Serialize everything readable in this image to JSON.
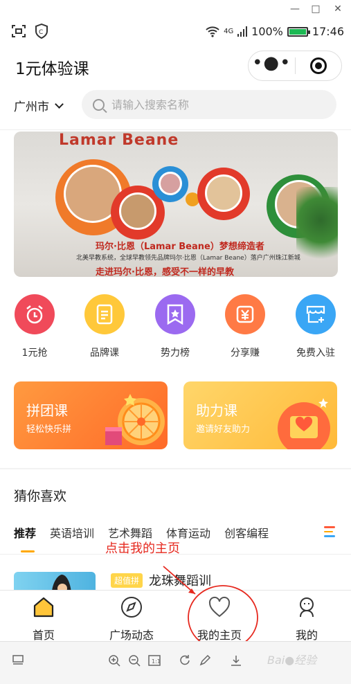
{
  "status": {
    "network": "4G",
    "battery": "100%",
    "time": "17:46"
  },
  "header": {
    "title": "1元体验课"
  },
  "location": {
    "city": "广州市"
  },
  "search": {
    "placeholder": "请输入搜索名称"
  },
  "banner": {
    "logo": "Lamar Beane",
    "slogan": "玛尔·比恩（Lamar Beane）梦想缔造者",
    "sub": "北美早教系统，全球早教领先品牌玛尔·比恩（Lamar Beane）落户广州珠江新城",
    "line3": "走进玛尔·比恩，感受不一样的早教"
  },
  "categories": [
    {
      "label": "1元抢",
      "color": "#f04a5a",
      "icon": "alarm-clock-icon"
    },
    {
      "label": "品牌课",
      "color": "#ffc83a",
      "icon": "document-icon"
    },
    {
      "label": "势力榜",
      "color": "#9b6af0",
      "icon": "bookmark-star-icon"
    },
    {
      "label": "分享赚",
      "color": "#ff7a45",
      "icon": "yuan-icon"
    },
    {
      "label": "免费入驻",
      "color": "#3aa6f5",
      "icon": "store-add-icon"
    }
  ],
  "promos": [
    {
      "title": "拼团课",
      "subtitle": "轻松快乐拼"
    },
    {
      "title": "助力课",
      "subtitle": "邀请好友助力"
    }
  ],
  "recommend": {
    "heading": "猜你喜欢",
    "tabs": [
      "推荐",
      "英语培训",
      "艺术舞蹈",
      "体育运动",
      "创客编程"
    ]
  },
  "course": {
    "badge": "超值拼",
    "title": "龙珠舞蹈训"
  },
  "bottom_nav": [
    {
      "label": "首页",
      "icon": "home-icon"
    },
    {
      "label": "广场动态",
      "icon": "compass-icon"
    },
    {
      "label": "我的主页",
      "icon": "heart-icon"
    },
    {
      "label": "我的",
      "icon": "user-icon"
    }
  ],
  "annotation": {
    "text": "点击我的主页"
  }
}
